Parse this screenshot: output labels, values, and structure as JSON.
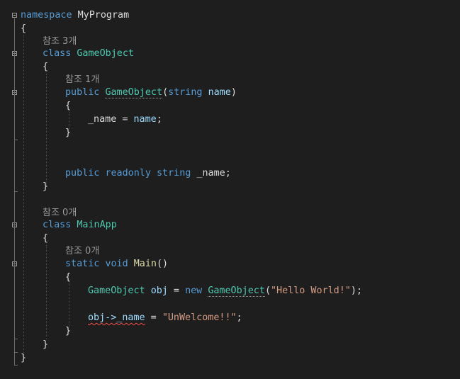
{
  "code": {
    "l1": {
      "ns_kw": "namespace",
      "ns_name": "MyProgram"
    },
    "l2": "{",
    "lens1": "참조 3개",
    "l3": {
      "kw": "class",
      "name": "GameObject"
    },
    "l4": "{",
    "lens2": "참조 1개",
    "l5": {
      "kw": "public",
      "ctor": "GameObject",
      "open": "(",
      "type": "string",
      "param": "name",
      "close": ")"
    },
    "l6": "{",
    "l7": {
      "field": "_name",
      "eq": " = ",
      "val": "name",
      "semi": ";"
    },
    "l8": "}",
    "l9": {
      "kw1": "public",
      "kw2": "readonly",
      "type": "string",
      "field": "_name;"
    },
    "l10": "}",
    "lens3": "참조 0개",
    "l11": {
      "kw": "class",
      "name": "MainApp"
    },
    "l12": "{",
    "lens4": "참조 0개",
    "l13": {
      "kw1": "static",
      "kw2": "void",
      "fn": "Main",
      "parens": "()"
    },
    "l14": "{",
    "l15": {
      "type": "GameObject",
      "var": "obj",
      "eq": " = ",
      "kw": "new",
      "ctor": "GameObject",
      "open": "(",
      "str": "\"Hello World!\"",
      "close": ");"
    },
    "l16": {
      "expr": "obj->_name",
      "eq": " = ",
      "str": "\"UnWelcome!!\"",
      "semi": ";"
    },
    "l17": "}",
    "l18": "}",
    "l19": "}"
  },
  "colors": {
    "background": "#1e1e1e",
    "keyword": "#569cd6",
    "type": "#4ec9b0",
    "identifier": "#9cdcfe",
    "function": "#dcdcaa",
    "string": "#d69d85",
    "error": "#f14c4c"
  }
}
